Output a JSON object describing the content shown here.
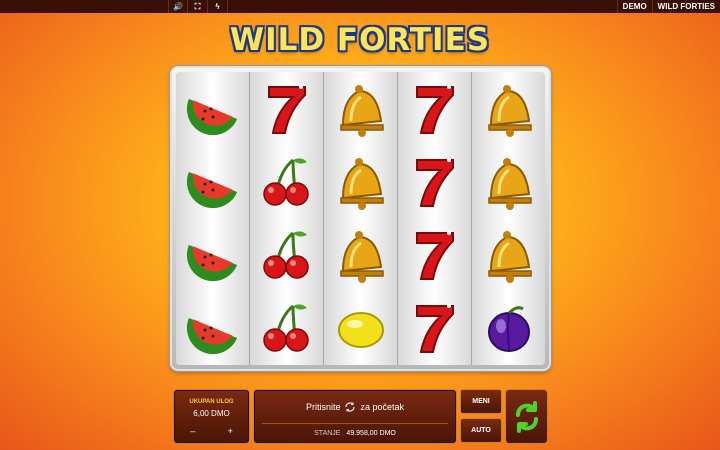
{
  "topbar": {
    "icons": [
      "speaker-icon",
      "fullscreen-icon",
      "turbo-icon"
    ],
    "mode": "DEMO",
    "game_name": "WILD FORTIES"
  },
  "title": "WILD FORTIES",
  "reels": [
    [
      "watermelon",
      "watermelon",
      "watermelon",
      "watermelon"
    ],
    [
      "seven",
      "cherry",
      "cherry",
      "cherry"
    ],
    [
      "bell",
      "bell",
      "bell",
      "lemon"
    ],
    [
      "seven",
      "seven",
      "seven",
      "seven"
    ],
    [
      "bell",
      "bell",
      "bell",
      "plum"
    ]
  ],
  "controls": {
    "bet_label": "UKUPAN ULOG",
    "bet_value": "6,00 DMO",
    "minus": "–",
    "plus": "+",
    "message_before": "Pritisnite",
    "message_after": "za početak",
    "balance_label": "STANJE",
    "balance_value": "49.958,00 DMO",
    "menu_label": "MENI",
    "auto_label": "AUTO"
  },
  "colors": {
    "accent_green": "#4fd22a",
    "gold": "#ffcc33",
    "panel_brown": "#5a1a08"
  }
}
